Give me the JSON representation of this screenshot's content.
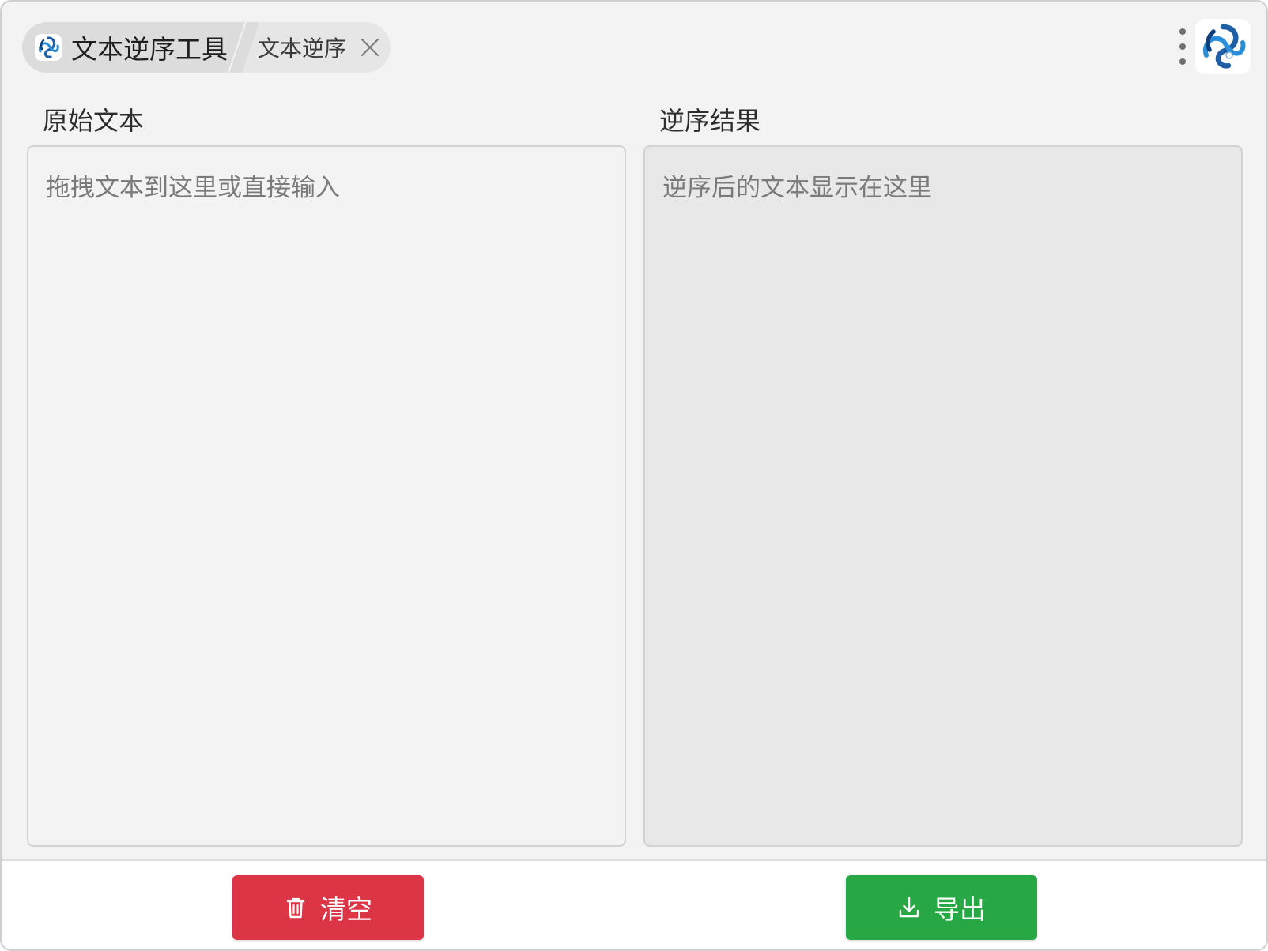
{
  "window": {
    "app_title": "文本逆序工具",
    "app_icon": "app-logo-icon",
    "brand_logo": "brand-logo-icon"
  },
  "tabs": [
    {
      "label": "文本逆序",
      "closable": true
    }
  ],
  "panels": {
    "left": {
      "label": "原始文本",
      "placeholder": "拖拽文本到这里或直接输入",
      "value": ""
    },
    "right": {
      "label": "逆序结果",
      "placeholder": "逆序后的文本显示在这里",
      "value": ""
    }
  },
  "buttons": {
    "clear": {
      "label": "清空",
      "icon": "trash-icon",
      "color": "#dc3545"
    },
    "export": {
      "label": "导出",
      "icon": "download-icon",
      "color": "#28a745"
    }
  },
  "colors": {
    "window_bg": "#f3f3f3",
    "output_bg": "#e8e8e8",
    "brand_blue": "#1f5fa8"
  }
}
